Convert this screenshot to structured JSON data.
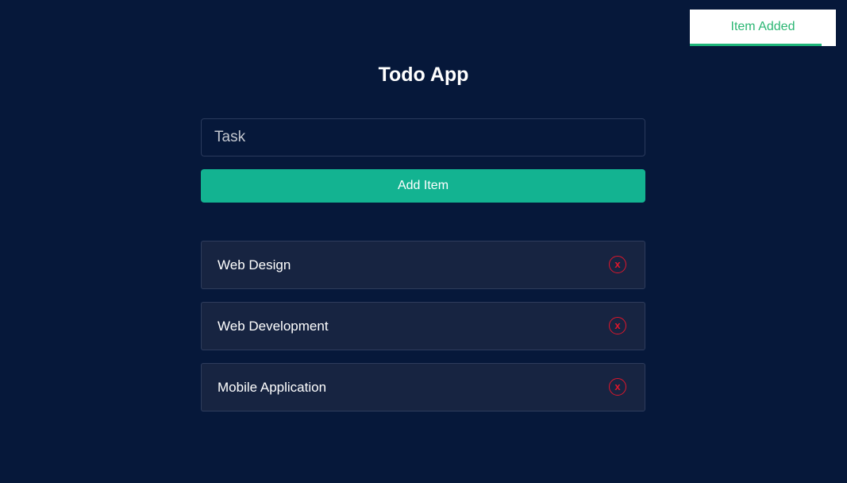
{
  "toast": {
    "message": "Item Added",
    "progress": 0.9,
    "color": "#2bb673"
  },
  "app": {
    "title": "Todo App"
  },
  "form": {
    "task_placeholder": "Task",
    "task_value": "",
    "add_label": "Add Item"
  },
  "todos": [
    {
      "label": "Web Design",
      "delete_icon": "close-circle-icon",
      "delete_glyph": "x"
    },
    {
      "label": "Web Development",
      "delete_icon": "close-circle-icon",
      "delete_glyph": "x"
    },
    {
      "label": "Mobile Application",
      "delete_icon": "close-circle-icon",
      "delete_glyph": "x"
    }
  ],
  "colors": {
    "background": "#06183a",
    "accent": "#13b391",
    "card": "#172441",
    "delete": "#e0162b"
  }
}
